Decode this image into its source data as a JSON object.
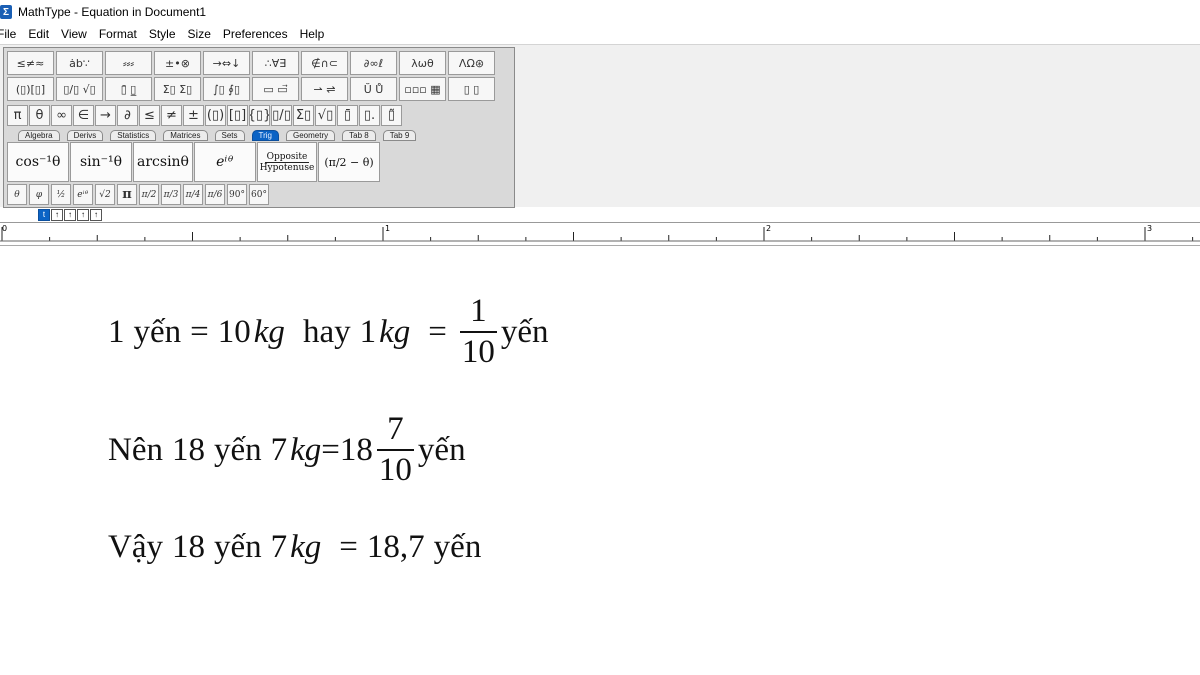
{
  "window": {
    "title": "MathType - Equation in Document1"
  },
  "menu": [
    {
      "label": "File"
    },
    {
      "label": "Edit"
    },
    {
      "label": "View"
    },
    {
      "label": "Format"
    },
    {
      "label": "Style"
    },
    {
      "label": "Size"
    },
    {
      "label": "Preferences"
    },
    {
      "label": "Help"
    }
  ],
  "palette": {
    "row1": [
      "≤≠≈",
      "ȧb∵",
      "⸗⸗⸗",
      "±•⊗",
      "→⇔↓",
      "∴∀∃",
      "∉∩⊂",
      "∂∞ℓ",
      "λωθ",
      "ΛΩ⊛"
    ],
    "row2": [
      "(▯)[▯]",
      "▯/▯ √▯",
      "▯̄ ▯̲",
      "Σ▯ Σ▯",
      "∫▯ ∮▯",
      "▭ ▭⃗",
      "⇀ ⇌",
      "Ŭ Ů",
      "▫▫▫ ▦",
      "▯ ▯"
    ],
    "row3": [
      "π",
      "θ",
      "∞",
      "∈",
      "→",
      "∂",
      "≤",
      "≠",
      "±",
      "(▯)",
      "[▯]",
      "{▯}",
      "▯/▯",
      "Σ▯",
      "√▯",
      "▯̄",
      "▯.",
      "▯̃"
    ],
    "tabs": [
      "Algebra",
      "Derivs",
      "Statistics",
      "Matrices",
      "Sets",
      "Trig",
      "Geometry",
      "Tab 8",
      "Tab 9"
    ],
    "active_tab": "Trig",
    "trig_templates": {
      "cos_inv": "cos⁻¹θ",
      "sin_inv": "sin⁻¹θ",
      "arcsin": "arcsinθ",
      "exp": "eⁱᶿ",
      "opposite": "Opposite",
      "hypotenuse": "Hypotenuse",
      "pi_minus": "(π/2 − θ)"
    },
    "row6": [
      "θ",
      "φ",
      "½",
      "eⁱᶿ",
      "√2",
      "π",
      "π/2",
      "π/3",
      "π/4",
      "π/6",
      "90°",
      "60°"
    ],
    "position_buttons": [
      "t",
      "↑",
      "↑",
      "↑",
      "↑"
    ]
  },
  "ruler": {
    "labels": [
      "0",
      "1",
      "2",
      "3"
    ]
  },
  "equations": {
    "line1": {
      "left_num": "1",
      "left_unit": "yến",
      "equals": "=",
      "value": "10",
      "kg": "kg",
      "hay": "hay",
      "one": "1",
      "kg2": "kg",
      "equals2": "=",
      "frac_num": "1",
      "frac_den": "10",
      "unit": "yến"
    },
    "line2": {
      "prefix": "Nên",
      "amount": "18",
      "unit1": "yến",
      "amount2": "7",
      "kg": "kg",
      "equals": "=",
      "whole": "18",
      "frac_num": "7",
      "frac_den": "10",
      "unit2": "yến"
    },
    "line3": {
      "prefix": "Vậy",
      "amount": "18",
      "unit1": "yến",
      "amount2": "7",
      "kg": "kg",
      "equals": "=",
      "result": "18,7",
      "unit2": "yến"
    }
  }
}
